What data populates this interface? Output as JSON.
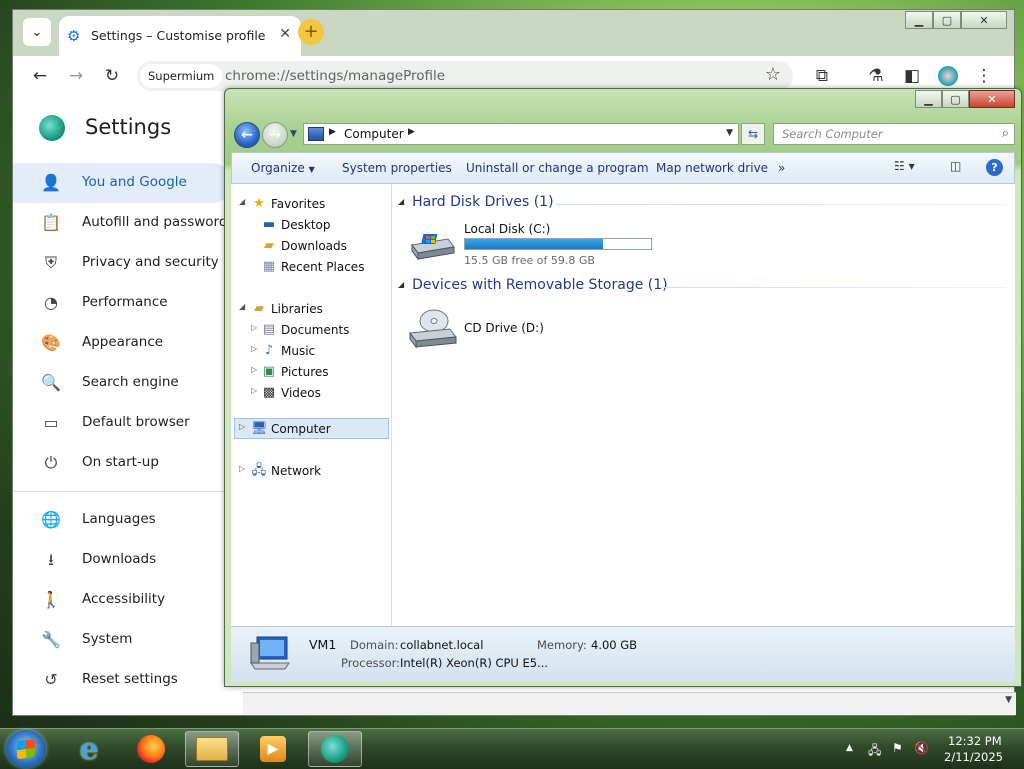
{
  "chrome": {
    "tab_title": "Settings – Customise profile",
    "site_chip": "Supermium",
    "url": "chrome://settings/manageProfile"
  },
  "settings": {
    "title": "Settings",
    "nav": [
      {
        "label": "You and Google",
        "icon": "person-icon"
      },
      {
        "label": "Autofill and passwords",
        "icon": "clipboard-icon"
      },
      {
        "label": "Privacy and security",
        "icon": "shield-icon"
      },
      {
        "label": "Performance",
        "icon": "gauge-icon"
      },
      {
        "label": "Appearance",
        "icon": "palette-icon"
      },
      {
        "label": "Search engine",
        "icon": "search-icon"
      },
      {
        "label": "Default browser",
        "icon": "browser-icon"
      },
      {
        "label": "On start-up",
        "icon": "power-icon"
      },
      {
        "label": "Languages",
        "icon": "globe-icon"
      },
      {
        "label": "Downloads",
        "icon": "download-icon"
      },
      {
        "label": "Accessibility",
        "icon": "accessibility-icon"
      },
      {
        "label": "System",
        "icon": "wrench-icon"
      },
      {
        "label": "Reset settings",
        "icon": "reset-icon"
      }
    ]
  },
  "explorer": {
    "address": "Computer",
    "search_placeholder": "Search Computer",
    "commands": [
      "Organize",
      "System properties",
      "Uninstall or change a program",
      "Map network drive",
      "»"
    ],
    "tree": {
      "favorites": "Favorites",
      "desktop": "Desktop",
      "downloads": "Downloads",
      "recent": "Recent Places",
      "libraries": "Libraries",
      "documents": "Documents",
      "music": "Music",
      "pictures": "Pictures",
      "videos": "Videos",
      "computer": "Computer",
      "network": "Network"
    },
    "groups": {
      "hdd": "Hard Disk Drives (1)",
      "removable": "Devices with Removable Storage (1)"
    },
    "disk": {
      "name": "Local Disk (C:)",
      "free_text": "15.5 GB free of 59.8 GB",
      "used_fraction": 0.74
    },
    "cd": {
      "name": "CD Drive (D:)"
    },
    "details": {
      "name": "VM1",
      "domain_label": "Domain:",
      "domain_value": "collabnet.local",
      "memory_label": "Memory:",
      "memory_value": "4.00 GB",
      "processor_label": "Processor:",
      "processor_value": "Intel(R) Xeon(R) CPU E5..."
    }
  },
  "taskbar": {
    "time": "12:32 PM",
    "date": "2/11/2025"
  },
  "colors": {
    "accent_blue": "#1a73e8",
    "explorer_link": "#1e3a8a",
    "disk_bar": "#1977c2"
  }
}
